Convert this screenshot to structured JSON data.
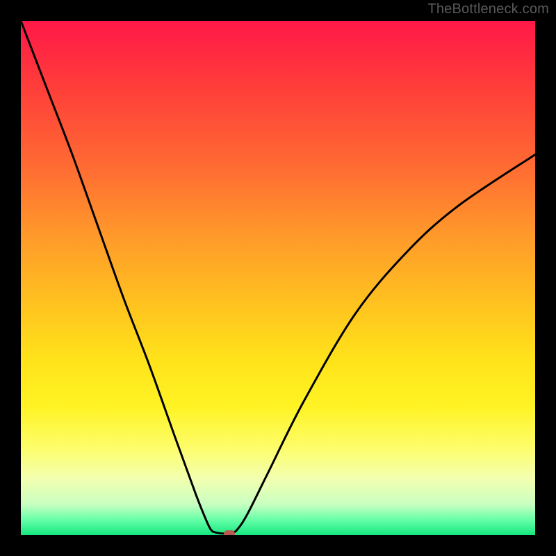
{
  "watermark": "TheBottleneck.com",
  "colors": {
    "background": "#000000",
    "gradient_top": "#ff1848",
    "gradient_bottom": "#14e67e",
    "curve": "#000000",
    "marker": "#b85a4f"
  },
  "chart_data": {
    "type": "line",
    "title": "",
    "xlabel": "",
    "ylabel": "",
    "xlim": [
      0,
      100
    ],
    "ylim": [
      0,
      100
    ],
    "grid": false,
    "legend": false,
    "series": [
      {
        "name": "bottleneck-curve",
        "x": [
          0,
          5,
          10,
          15,
          20,
          25,
          30,
          34,
          36,
          37,
          38,
          40,
          41,
          42,
          44,
          48,
          55,
          65,
          75,
          85,
          100
        ],
        "y": [
          100,
          87,
          74,
          60,
          46,
          33,
          19,
          8,
          3,
          1,
          0.5,
          0.3,
          0.5,
          1,
          4,
          12,
          26,
          43,
          55,
          64,
          74
        ]
      }
    ],
    "marker": {
      "x": 40.5,
      "y": 0.3
    },
    "notes": "V-shaped bottleneck curve on a red-to-green vertical gradient. Minimum near x≈40. Values estimated from pixel positions; no axis ticks or labels are rendered in the source image."
  }
}
